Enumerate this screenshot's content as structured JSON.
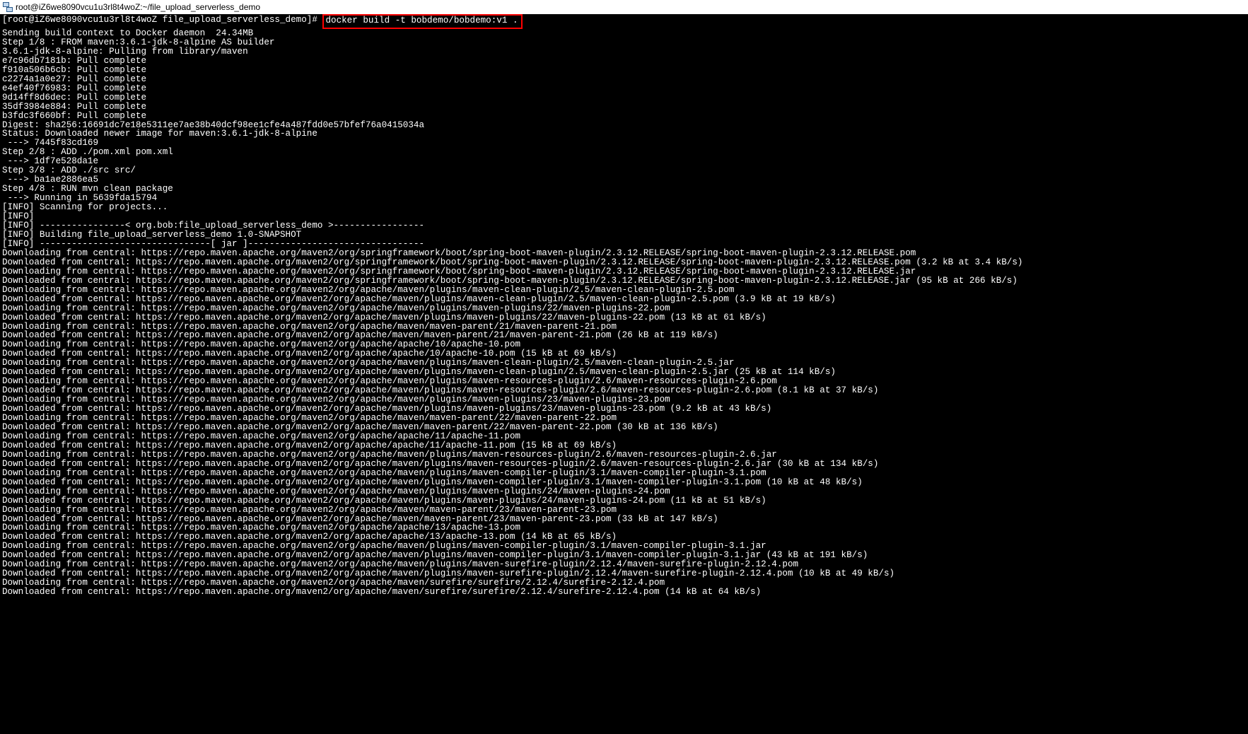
{
  "window": {
    "title": "root@iZ6we8090vcu1u3rl8t4woZ:~/file_upload_serverless_demo"
  },
  "prompt": {
    "text": "[root@iZ6we8090vcu1u3rl8t4woZ file_upload_serverless_demo]# ",
    "command": "docker build -t bobdemo/bobdemo:v1 ."
  },
  "lines": [
    "Sending build context to Docker daemon  24.34MB",
    "Step 1/8 : FROM maven:3.6.1-jdk-8-alpine AS builder",
    "3.6.1-jdk-8-alpine: Pulling from library/maven",
    "e7c96db7181b: Pull complete",
    "f910a506b6cb: Pull complete",
    "c2274a1a0e27: Pull complete",
    "e4ef40f76983: Pull complete",
    "9d14ff8d6dec: Pull complete",
    "35df3984e884: Pull complete",
    "b3fdc3f660bf: Pull complete",
    "Digest: sha256:16691dc7e18e5311ee7ae38b40dcf98ee1cfe4a487fdd0e57bfef76a0415034a",
    "Status: Downloaded newer image for maven:3.6.1-jdk-8-alpine",
    " ---> 7445f83cd169",
    "Step 2/8 : ADD ./pom.xml pom.xml",
    " ---> 1df7e528da1e",
    "Step 3/8 : ADD ./src src/",
    " ---> ba1ae2886ea5",
    "Step 4/8 : RUN mvn clean package",
    " ---> Running in 5639fda15794",
    "[INFO] Scanning for projects...",
    "[INFO]",
    "[INFO] ----------------< org.bob:file_upload_serverless_demo >-----------------",
    "[INFO] Building file_upload_serverless_demo 1.0-SNAPSHOT",
    "[INFO] --------------------------------[ jar ]---------------------------------",
    "Downloading from central: https://repo.maven.apache.org/maven2/org/springframework/boot/spring-boot-maven-plugin/2.3.12.RELEASE/spring-boot-maven-plugin-2.3.12.RELEASE.pom",
    "Downloaded from central: https://repo.maven.apache.org/maven2/org/springframework/boot/spring-boot-maven-plugin/2.3.12.RELEASE/spring-boot-maven-plugin-2.3.12.RELEASE.pom (3.2 kB at 3.4 kB/s)",
    "Downloading from central: https://repo.maven.apache.org/maven2/org/springframework/boot/spring-boot-maven-plugin/2.3.12.RELEASE/spring-boot-maven-plugin-2.3.12.RELEASE.jar",
    "Downloaded from central: https://repo.maven.apache.org/maven2/org/springframework/boot/spring-boot-maven-plugin/2.3.12.RELEASE/spring-boot-maven-plugin-2.3.12.RELEASE.jar (95 kB at 266 kB/s)",
    "Downloading from central: https://repo.maven.apache.org/maven2/org/apache/maven/plugins/maven-clean-plugin/2.5/maven-clean-plugin-2.5.pom",
    "Downloaded from central: https://repo.maven.apache.org/maven2/org/apache/maven/plugins/maven-clean-plugin/2.5/maven-clean-plugin-2.5.pom (3.9 kB at 19 kB/s)",
    "Downloading from central: https://repo.maven.apache.org/maven2/org/apache/maven/plugins/maven-plugins/22/maven-plugins-22.pom",
    "Downloaded from central: https://repo.maven.apache.org/maven2/org/apache/maven/plugins/maven-plugins/22/maven-plugins-22.pom (13 kB at 61 kB/s)",
    "Downloading from central: https://repo.maven.apache.org/maven2/org/apache/maven/maven-parent/21/maven-parent-21.pom",
    "Downloaded from central: https://repo.maven.apache.org/maven2/org/apache/maven/maven-parent/21/maven-parent-21.pom (26 kB at 119 kB/s)",
    "Downloading from central: https://repo.maven.apache.org/maven2/org/apache/apache/10/apache-10.pom",
    "Downloaded from central: https://repo.maven.apache.org/maven2/org/apache/apache/10/apache-10.pom (15 kB at 69 kB/s)",
    "Downloading from central: https://repo.maven.apache.org/maven2/org/apache/maven/plugins/maven-clean-plugin/2.5/maven-clean-plugin-2.5.jar",
    "Downloaded from central: https://repo.maven.apache.org/maven2/org/apache/maven/plugins/maven-clean-plugin/2.5/maven-clean-plugin-2.5.jar (25 kB at 114 kB/s)",
    "Downloading from central: https://repo.maven.apache.org/maven2/org/apache/maven/plugins/maven-resources-plugin/2.6/maven-resources-plugin-2.6.pom",
    "Downloaded from central: https://repo.maven.apache.org/maven2/org/apache/maven/plugins/maven-resources-plugin/2.6/maven-resources-plugin-2.6.pom (8.1 kB at 37 kB/s)",
    "Downloading from central: https://repo.maven.apache.org/maven2/org/apache/maven/plugins/maven-plugins/23/maven-plugins-23.pom",
    "Downloaded from central: https://repo.maven.apache.org/maven2/org/apache/maven/plugins/maven-plugins/23/maven-plugins-23.pom (9.2 kB at 43 kB/s)",
    "Downloading from central: https://repo.maven.apache.org/maven2/org/apache/maven/maven-parent/22/maven-parent-22.pom",
    "Downloaded from central: https://repo.maven.apache.org/maven2/org/apache/maven/maven-parent/22/maven-parent-22.pom (30 kB at 136 kB/s)",
    "Downloading from central: https://repo.maven.apache.org/maven2/org/apache/apache/11/apache-11.pom",
    "Downloaded from central: https://repo.maven.apache.org/maven2/org/apache/apache/11/apache-11.pom (15 kB at 69 kB/s)",
    "Downloading from central: https://repo.maven.apache.org/maven2/org/apache/maven/plugins/maven-resources-plugin/2.6/maven-resources-plugin-2.6.jar",
    "Downloaded from central: https://repo.maven.apache.org/maven2/org/apache/maven/plugins/maven-resources-plugin/2.6/maven-resources-plugin-2.6.jar (30 kB at 134 kB/s)",
    "Downloading from central: https://repo.maven.apache.org/maven2/org/apache/maven/plugins/maven-compiler-plugin/3.1/maven-compiler-plugin-3.1.pom",
    "Downloaded from central: https://repo.maven.apache.org/maven2/org/apache/maven/plugins/maven-compiler-plugin/3.1/maven-compiler-plugin-3.1.pom (10 kB at 48 kB/s)",
    "Downloading from central: https://repo.maven.apache.org/maven2/org/apache/maven/plugins/maven-plugins/24/maven-plugins-24.pom",
    "Downloaded from central: https://repo.maven.apache.org/maven2/org/apache/maven/plugins/maven-plugins/24/maven-plugins-24.pom (11 kB at 51 kB/s)",
    "Downloading from central: https://repo.maven.apache.org/maven2/org/apache/maven/maven-parent/23/maven-parent-23.pom",
    "Downloaded from central: https://repo.maven.apache.org/maven2/org/apache/maven/maven-parent/23/maven-parent-23.pom (33 kB at 147 kB/s)",
    "Downloading from central: https://repo.maven.apache.org/maven2/org/apache/apache/13/apache-13.pom",
    "Downloaded from central: https://repo.maven.apache.org/maven2/org/apache/apache/13/apache-13.pom (14 kB at 65 kB/s)",
    "Downloading from central: https://repo.maven.apache.org/maven2/org/apache/maven/plugins/maven-compiler-plugin/3.1/maven-compiler-plugin-3.1.jar",
    "Downloaded from central: https://repo.maven.apache.org/maven2/org/apache/maven/plugins/maven-compiler-plugin/3.1/maven-compiler-plugin-3.1.jar (43 kB at 191 kB/s)",
    "Downloading from central: https://repo.maven.apache.org/maven2/org/apache/maven/plugins/maven-surefire-plugin/2.12.4/maven-surefire-plugin-2.12.4.pom",
    "Downloaded from central: https://repo.maven.apache.org/maven2/org/apache/maven/plugins/maven-surefire-plugin/2.12.4/maven-surefire-plugin-2.12.4.pom (10 kB at 49 kB/s)",
    "Downloading from central: https://repo.maven.apache.org/maven2/org/apache/maven/surefire/surefire/2.12.4/surefire-2.12.4.pom",
    "Downloaded from central: https://repo.maven.apache.org/maven2/org/apache/maven/surefire/surefire/2.12.4/surefire-2.12.4.pom (14 kB at 64 kB/s)"
  ]
}
